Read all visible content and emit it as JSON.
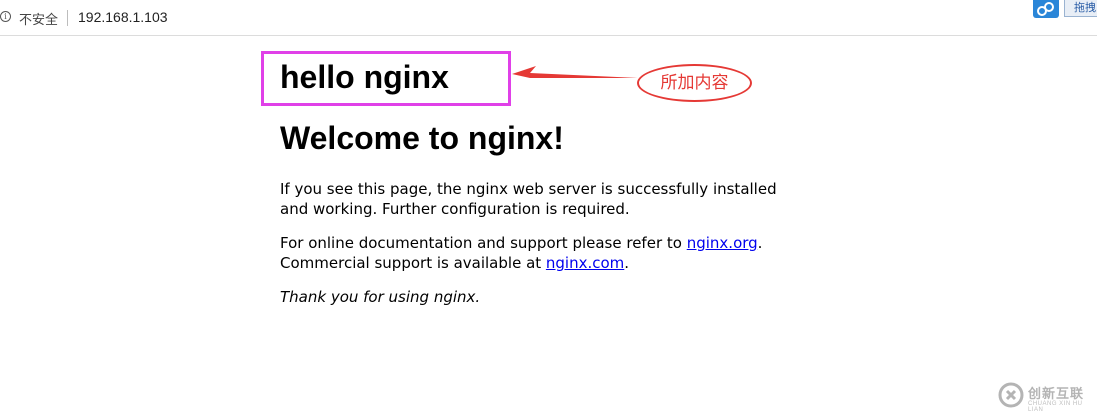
{
  "browser": {
    "security_label": "不安全",
    "url": "192.168.1.103",
    "ext_label": "拖拽"
  },
  "page": {
    "added_heading": "hello nginx",
    "title": "Welcome to nginx!",
    "p1": "If you see this page, the nginx web server is successfully installed and working. Further configuration is required.",
    "p2_prefix": "For online documentation and support please refer to ",
    "link_org": "nginx.org",
    "p2_mid": ".",
    "p2_line2_prefix": "Commercial support is available at ",
    "link_com": "nginx.com",
    "p2_suffix": ".",
    "p3": "Thank you for using nginx."
  },
  "annotation": {
    "callout_text": "所加内容",
    "box_color": "#e040e8",
    "arrow_color": "#e53935"
  },
  "watermark": {
    "text": "创新互联",
    "sub": "CHUANG XIN HU LIAN"
  }
}
